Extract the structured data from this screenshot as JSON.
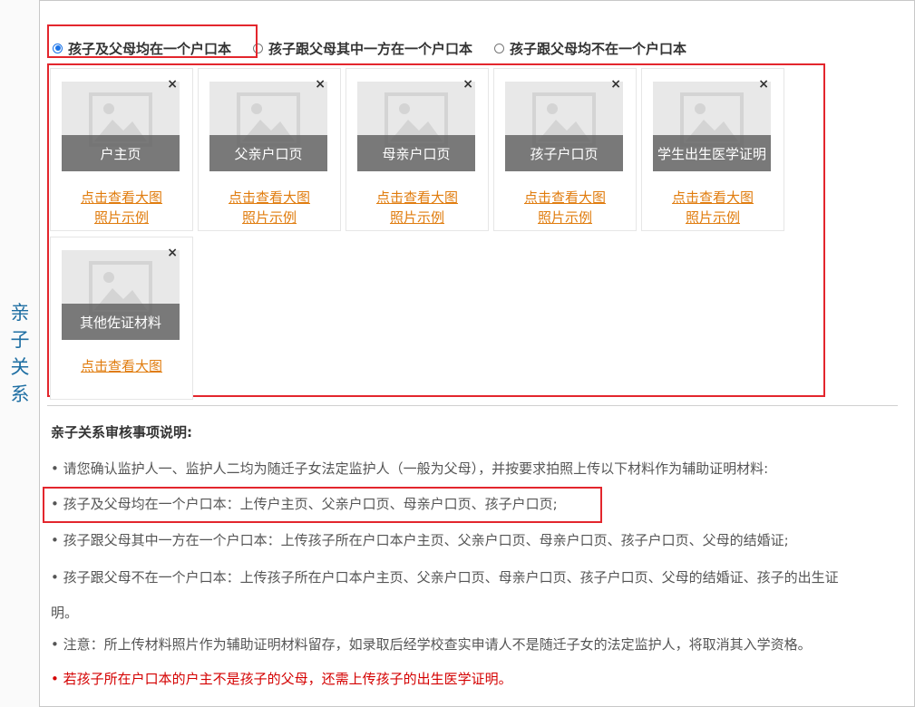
{
  "section_label": "亲子关系",
  "radio": {
    "options": [
      {
        "label": "孩子及父母均在一个户口本",
        "checked": true
      },
      {
        "label": "孩子跟父母其中一方在一个户口本",
        "checked": false
      },
      {
        "label": "孩子跟父母均不在一个户口本",
        "checked": false
      }
    ]
  },
  "uploads": [
    {
      "title": "户主页",
      "view_link": "点击查看大图",
      "example_link": "照片示例"
    },
    {
      "title": "父亲户口页",
      "view_link": "点击查看大图",
      "example_link": "照片示例"
    },
    {
      "title": "母亲户口页",
      "view_link": "点击查看大图",
      "example_link": "照片示例"
    },
    {
      "title": "孩子户口页",
      "view_link": "点击查看大图",
      "example_link": "照片示例"
    },
    {
      "title": "学生出生医学证明",
      "view_link": "点击查看大图",
      "example_link": "照片示例"
    },
    {
      "title": "其他佐证材料",
      "view_link": "点击查看大图"
    }
  ],
  "close_glyph": "×",
  "notes": {
    "title": "亲子关系审核事项说明:",
    "lines": [
      "• 请您确认监护人一、监护人二均为随迁子女法定监护人（一般为父母），并按要求拍照上传以下材料作为辅助证明材料:",
      "• 孩子及父母均在一个户口本：上传户主页、父亲户口页、母亲户口页、孩子户口页;",
      "• 孩子跟父母其中一方在一个户口本：上传孩子所在户口本户主页、父亲户口页、母亲户口页、孩子户口页、父母的结婚证;",
      "• 孩子跟父母不在一个户口本：上传孩子所在户口本户主页、父亲户口页、母亲户口页、孩子户口页、父母的结婚证、孩子的出生证",
      "明。",
      "• 注意：所上传材料照片作为辅助证明材料留存，如录取后经学校查实申请人不是随迁子女的法定监护人，将取消其入学资格。",
      "• 若孩子所在户口本的户主不是孩子的父母，还需上传孩子的出生医学证明。"
    ]
  },
  "colors": {
    "highlight": "#e3262d",
    "link": "#e07c0e",
    "label": "#1f6fa3",
    "warning": "#d40000"
  }
}
